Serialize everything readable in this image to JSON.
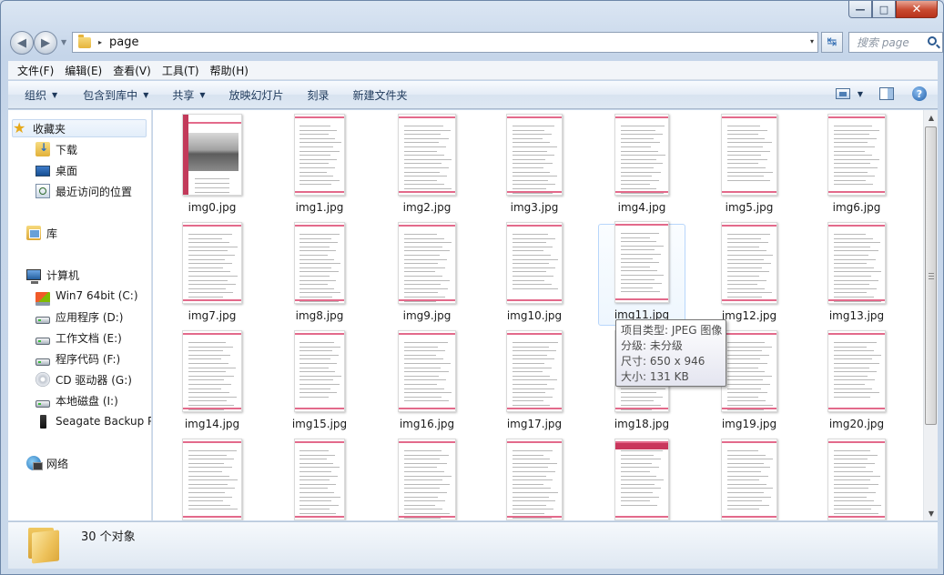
{
  "window": {
    "caption_minimize": "—",
    "caption_maximize": "□",
    "caption_close": "✕"
  },
  "nav": {
    "back_glyph": "◀",
    "forward_glyph": "▶",
    "dropdown_glyph": "▼"
  },
  "address": {
    "path": "page",
    "separator": "▸",
    "dropdown": "▾"
  },
  "refresh": {
    "glyph": "↹"
  },
  "search": {
    "placeholder": "搜索 page",
    "value": ""
  },
  "menubar": [
    "文件(F)",
    "编辑(E)",
    "查看(V)",
    "工具(T)",
    "帮助(H)"
  ],
  "commands": {
    "organize": "组织",
    "include_library": "包含到库中",
    "share": "共享",
    "slideshow": "放映幻灯片",
    "burn": "刻录",
    "new_folder": "新建文件夹",
    "caret": "▼",
    "help": "?"
  },
  "navpane": {
    "favorites": "收藏夹",
    "downloads": "下载",
    "desktop": "桌面",
    "recent": "最近访问的位置",
    "libraries": "库",
    "computer": "计算机",
    "drives": [
      {
        "label": "Win7 64bit (C:)"
      },
      {
        "label": "应用程序 (D:)"
      },
      {
        "label": "工作文档 (E:)"
      },
      {
        "label": "程序代码 (F:)"
      },
      {
        "label": "CD 驱动器 (G:)"
      },
      {
        "label": "本地磁盘 (I:)"
      },
      {
        "label": "Seagate Backup P"
      }
    ],
    "network": "网络"
  },
  "files": [
    "img0.jpg",
    "img1.jpg",
    "img2.jpg",
    "img3.jpg",
    "img4.jpg",
    "img5.jpg",
    "img6.jpg",
    "img7.jpg",
    "img8.jpg",
    "img9.jpg",
    "img10.jpg",
    "img11.jpg",
    "img12.jpg",
    "img13.jpg",
    "img14.jpg",
    "img15.jpg",
    "img16.jpg",
    "img17.jpg",
    "img18.jpg",
    "img19.jpg",
    "img20.jpg",
    "",
    "",
    "",
    "",
    "",
    "",
    ""
  ],
  "tooltip": {
    "type": "项目类型: JPEG 图像",
    "rating": "分级: 未分级",
    "dimensions": "尺寸: 650 x 946",
    "size": "大小: 131 KB"
  },
  "scrollbar": {
    "up": "▲",
    "down": "▼"
  },
  "status": {
    "count": "30 个对象"
  },
  "colors": {
    "accent": "#c9365c",
    "selection": "#b8d6fb"
  }
}
